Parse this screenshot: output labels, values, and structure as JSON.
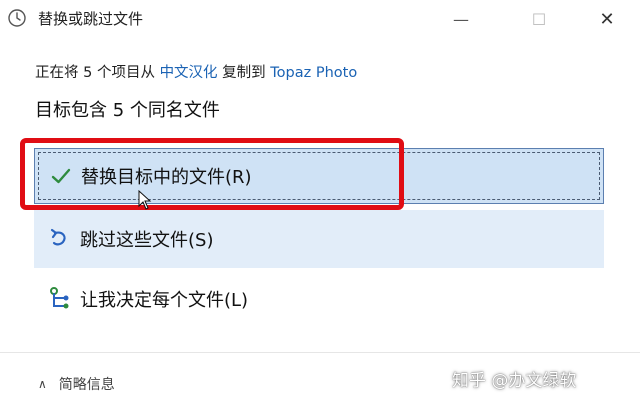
{
  "window": {
    "title": "替换或跳过文件",
    "min_glyph": "—",
    "max_glyph": "☐",
    "close_glyph": "✕"
  },
  "copy_status": {
    "prefix": "正在将 5 个项目从 ",
    "source": "中文汉化",
    "middle": " 复制到 ",
    "destination": "Topaz Photo"
  },
  "heading": "目标包含 5 个同名文件",
  "options": {
    "replace": {
      "label": "替换目标中的文件(R)",
      "icon": "checkmark-icon",
      "color": "#2e8b3e"
    },
    "skip": {
      "label": "跳过这些文件(S)",
      "icon": "skip-arrow-icon",
      "color": "#2a64c0"
    },
    "decide": {
      "label": "让我决定每个文件(L)",
      "icon": "decide-icon",
      "color": "#2a64c0"
    }
  },
  "footer": {
    "toggle_label": "简略信息",
    "chevron": "∧"
  },
  "watermark": "知乎 @办文绿软",
  "colors": {
    "highlight": "#e00d14",
    "link": "#1b63b4",
    "selected_bg": "#cfe2f5"
  }
}
